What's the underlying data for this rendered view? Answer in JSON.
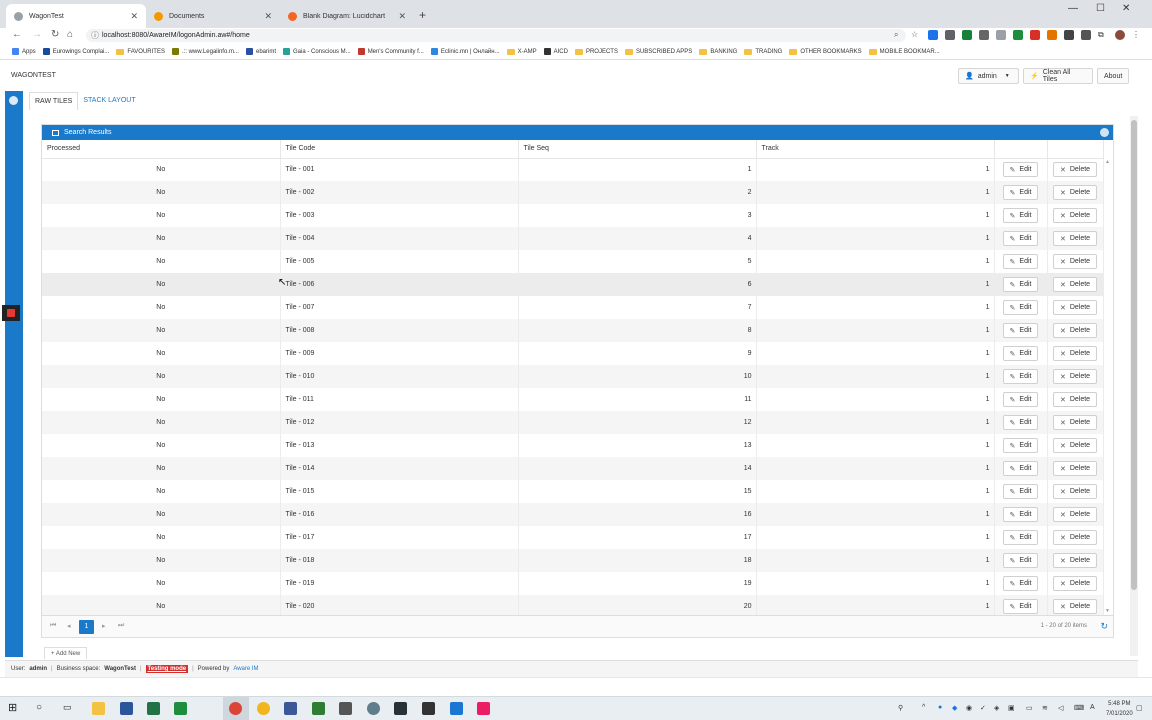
{
  "browser": {
    "tabs": [
      {
        "title": "WagonTest",
        "active": true
      },
      {
        "title": "Documents",
        "active": false
      },
      {
        "title": "Blank Diagram: Lucidchart",
        "active": false
      }
    ],
    "url": "localhost:8080/AwareIM/logonAdmin.aw#/home",
    "bookmarks": [
      {
        "label": "Apps",
        "kind": "apps"
      },
      {
        "label": "Eurowings Complai...",
        "kind": "fav",
        "color": "#1a4b9b"
      },
      {
        "label": "FAVOURITES",
        "kind": "folder"
      },
      {
        "label": ".:: www.Legalinfo.m...",
        "kind": "fav",
        "color": "#7a7a00"
      },
      {
        "label": "ebarimt",
        "kind": "fav",
        "color": "#2b4fa3"
      },
      {
        "label": "Gaia - Conscious M...",
        "kind": "fav",
        "color": "#2aa198"
      },
      {
        "label": "Men's Community f...",
        "kind": "fav",
        "color": "#c0392b"
      },
      {
        "label": "Eclinic.mn | Онлайн...",
        "kind": "fav",
        "color": "#2e86de"
      },
      {
        "label": "X-AMP",
        "kind": "folder"
      },
      {
        "label": "AICD",
        "kind": "fav",
        "color": "#333333"
      },
      {
        "label": "PROJECTS",
        "kind": "folder"
      },
      {
        "label": "SUBSCRIBED APPS",
        "kind": "folder"
      },
      {
        "label": "BANKING",
        "kind": "folder"
      },
      {
        "label": "TRADING",
        "kind": "folder"
      },
      {
        "label": "OTHER BOOKMARKS",
        "kind": "folder"
      },
      {
        "label": "MOBILE BOOKMAR...",
        "kind": "folder"
      }
    ]
  },
  "app": {
    "brand": "WAGONTEST",
    "user_button": "admin",
    "clean_button": "Clean All Tiles",
    "about_button": "About",
    "subtabs": [
      "RAW TILES",
      "STACK LAYOUT"
    ],
    "panel_title": "Search Results",
    "columns": [
      "Processed",
      "Tile Code",
      "Tile Seq",
      "Track"
    ],
    "edit_label": "Edit",
    "delete_label": "Delete",
    "rows": [
      {
        "processed": "No",
        "code": "Tile - 001",
        "seq": "1",
        "track": "1"
      },
      {
        "processed": "No",
        "code": "Tile - 002",
        "seq": "2",
        "track": "1"
      },
      {
        "processed": "No",
        "code": "Tile - 003",
        "seq": "3",
        "track": "1"
      },
      {
        "processed": "No",
        "code": "Tile - 004",
        "seq": "4",
        "track": "1"
      },
      {
        "processed": "No",
        "code": "Tile - 005",
        "seq": "5",
        "track": "1"
      },
      {
        "processed": "No",
        "code": "Tile - 006",
        "seq": "6",
        "track": "1"
      },
      {
        "processed": "No",
        "code": "Tile - 007",
        "seq": "7",
        "track": "1"
      },
      {
        "processed": "No",
        "code": "Tile - 008",
        "seq": "8",
        "track": "1"
      },
      {
        "processed": "No",
        "code": "Tile - 009",
        "seq": "9",
        "track": "1"
      },
      {
        "processed": "No",
        "code": "Tile - 010",
        "seq": "10",
        "track": "1"
      },
      {
        "processed": "No",
        "code": "Tile - 011",
        "seq": "11",
        "track": "1"
      },
      {
        "processed": "No",
        "code": "Tile - 012",
        "seq": "12",
        "track": "1"
      },
      {
        "processed": "No",
        "code": "Tile - 013",
        "seq": "13",
        "track": "1"
      },
      {
        "processed": "No",
        "code": "Tile - 014",
        "seq": "14",
        "track": "1"
      },
      {
        "processed": "No",
        "code": "Tile - 015",
        "seq": "15",
        "track": "1"
      },
      {
        "processed": "No",
        "code": "Tile - 016",
        "seq": "16",
        "track": "1"
      },
      {
        "processed": "No",
        "code": "Tile - 017",
        "seq": "17",
        "track": "1"
      },
      {
        "processed": "No",
        "code": "Tile - 018",
        "seq": "18",
        "track": "1"
      },
      {
        "processed": "No",
        "code": "Tile - 019",
        "seq": "19",
        "track": "1"
      },
      {
        "processed": "No",
        "code": "Tile - 020",
        "seq": "20",
        "track": "1"
      }
    ],
    "pager": {
      "current": "1",
      "info": "1 - 20 of 20 items"
    },
    "add_new": "Add New",
    "status": {
      "user_label": "User:",
      "user": "admin",
      "space_label": "Business space:",
      "space": "WagonTest",
      "mode": "Testing mode",
      "powered": "Powered by",
      "vendor": "Aware IM"
    }
  },
  "taskbar": {
    "time": "5:48 PM",
    "date": "7/01/2020"
  },
  "colors": {
    "accent": "#1a7ac9",
    "testing_mode": "#d32f2f"
  }
}
